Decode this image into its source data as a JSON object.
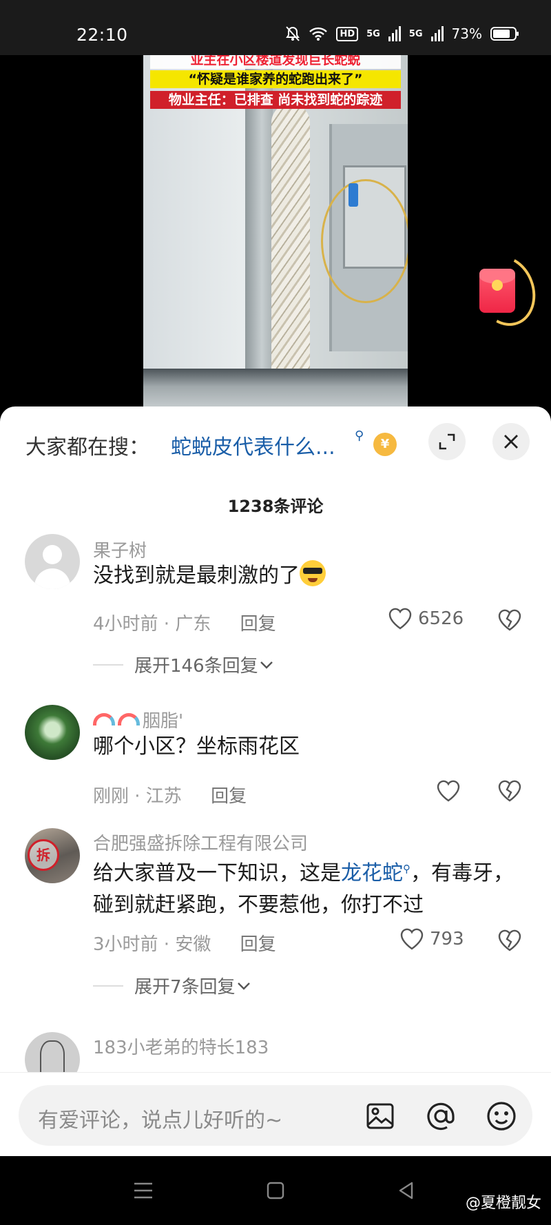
{
  "status_bar": {
    "time": "22:10",
    "hd": "HD",
    "net1": "5G",
    "net2": "5G",
    "battery": "73%"
  },
  "video": {
    "caption_line1": "业主在小区楼道发现巨长蛇蜕",
    "caption_line2": "“怀疑是谁家养的蛇跑出来了”",
    "caption_line3": "物业主任：已排查 尚未找到蛇的踪迹"
  },
  "trending": {
    "label": "大家都在搜：",
    "query": "蛇蜕皮代表什么...",
    "coin_symbol": "¥"
  },
  "comment_count": "1238条评论",
  "comments": [
    {
      "name": "果子树",
      "text": "没找到就是最刺激的了",
      "time_loc": "4小时前 · 广东",
      "reply": "回复",
      "likes": "6526",
      "expand": "展开146条回复"
    },
    {
      "name": "胭脂'",
      "text": "哪个小区？坐标雨花区",
      "time_loc": "刚刚 · 江苏",
      "reply": "回复",
      "likes": ""
    },
    {
      "name": "合肥强盛拆除工程有限公司",
      "text_pre": "给大家普及一下知识，这是",
      "text_link": "龙花蛇",
      "text_post": "，有毒牙，碰到就赶紧跑，不要惹他，你打不过",
      "time_loc": "3小时前 · 安徽",
      "reply": "回复",
      "likes": "793",
      "expand": "展开7条回复",
      "avatar_char": "拆"
    },
    {
      "name": "183小老弟的特长183"
    }
  ],
  "input": {
    "placeholder": "有爱评论，说点儿好听的~"
  },
  "watermark": "@夏橙靓女",
  "colors": {
    "link": "#1a5ea8",
    "caption_yellow": "#f5e600",
    "caption_red": "#d0202a",
    "red_packet": "#ef2646"
  }
}
